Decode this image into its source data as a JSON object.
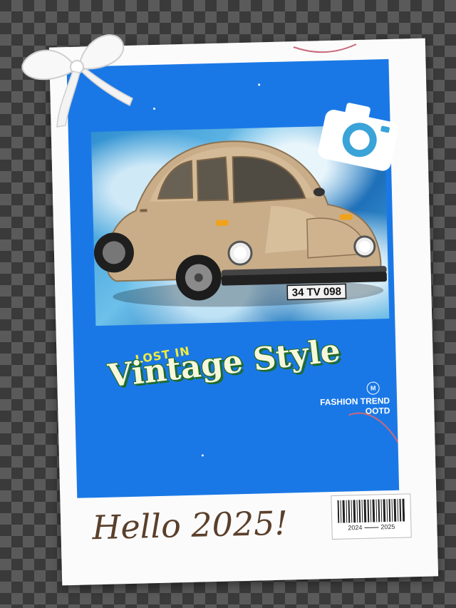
{
  "inset_photo": {
    "license_plate": "34 TV 098"
  },
  "headline": {
    "small": "LOST IN",
    "large": "Vintage Style"
  },
  "badge": {
    "letter": "M",
    "line1": "FASHION TREND",
    "line2": "OOTD"
  },
  "caption": "Hello 2025!",
  "barcode": {
    "year_start": "2024",
    "year_end": "2025"
  },
  "colors": {
    "photo_bg": "#1a78e6",
    "headline_small": "#f4ec3a",
    "headline_large": "#f7f7dc",
    "headline_outline": "#1f6b2a",
    "caption": "#5a3f2a",
    "frame": "#fbfbfb"
  },
  "icons": [
    "ribbon-bow",
    "camera-icon",
    "barcode"
  ]
}
